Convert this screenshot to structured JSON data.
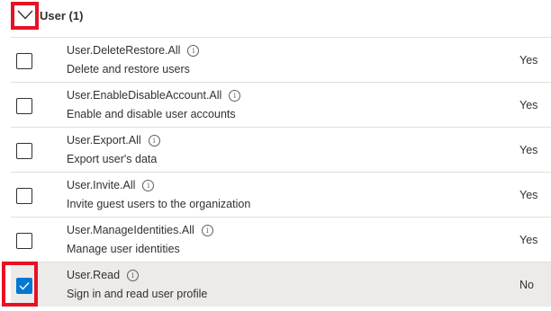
{
  "group": {
    "title": "User (1)",
    "icon": "chevron-down-icon"
  },
  "colors": {
    "highlight": "#e81123",
    "checked": "#0078d4",
    "selected_row": "#edebe9"
  },
  "permissions": [
    {
      "name": "User.DeleteRestore.All",
      "description": "Delete and restore users",
      "admin_consent": "Yes",
      "checked": false
    },
    {
      "name": "User.EnableDisableAccount.All",
      "description": "Enable and disable user accounts",
      "admin_consent": "Yes",
      "checked": false
    },
    {
      "name": "User.Export.All",
      "description": "Export user's data",
      "admin_consent": "Yes",
      "checked": false
    },
    {
      "name": "User.Invite.All",
      "description": "Invite guest users to the organization",
      "admin_consent": "Yes",
      "checked": false
    },
    {
      "name": "User.ManageIdentities.All",
      "description": "Manage user identities",
      "admin_consent": "Yes",
      "checked": false
    },
    {
      "name": "User.Read",
      "description": "Sign in and read user profile",
      "admin_consent": "No",
      "checked": true
    }
  ]
}
